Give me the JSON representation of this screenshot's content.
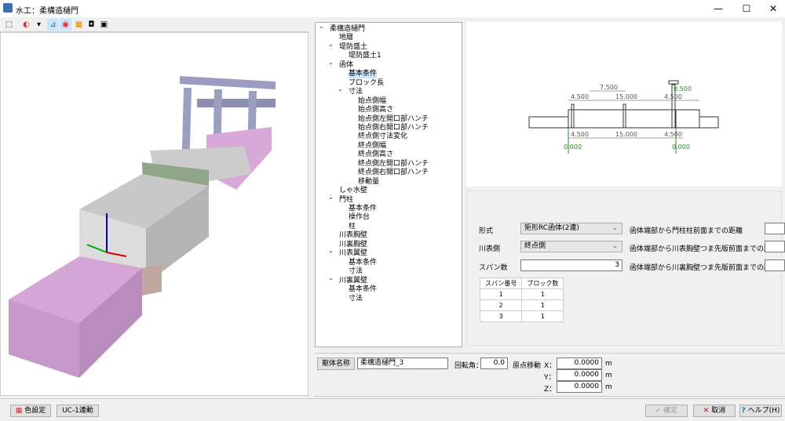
{
  "window": {
    "title": "水工：柔構造樋門",
    "minimize": "—",
    "maximize": "☐",
    "close": "✕"
  },
  "toolbar": {
    "icons": [
      "select-icon",
      "color-view-icon",
      "dropdown-icon",
      "axis-icon",
      "target-icon",
      "palette-icon",
      "camera-icon",
      "movie-icon"
    ]
  },
  "tree": [
    {
      "label": "柔構造樋門",
      "depth": 0,
      "exp": true
    },
    {
      "label": "地層",
      "depth": 1
    },
    {
      "label": "堤防盛土",
      "depth": 1,
      "exp": true
    },
    {
      "label": "堤防盛土1",
      "depth": 2
    },
    {
      "label": "函体",
      "depth": 1,
      "exp": true
    },
    {
      "label": "基本条件",
      "depth": 2,
      "selected": true
    },
    {
      "label": "ブロック長",
      "depth": 2
    },
    {
      "label": "寸法",
      "depth": 2,
      "exp": true
    },
    {
      "label": "始点側幅",
      "depth": 3
    },
    {
      "label": "始点側高さ",
      "depth": 3
    },
    {
      "label": "始点側左開口部ハンチ",
      "depth": 3
    },
    {
      "label": "始点側右開口部ハンチ",
      "depth": 3
    },
    {
      "label": "終点側寸法変化",
      "depth": 3
    },
    {
      "label": "終点側幅",
      "depth": 3
    },
    {
      "label": "終点側高さ",
      "depth": 3
    },
    {
      "label": "終点側左開口部ハンチ",
      "depth": 3
    },
    {
      "label": "終点側右開口部ハンチ",
      "depth": 3
    },
    {
      "label": "移動量",
      "depth": 3
    },
    {
      "label": "しゃ水壁",
      "depth": 1
    },
    {
      "label": "門柱",
      "depth": 1,
      "exp": true
    },
    {
      "label": "基本条件",
      "depth": 2
    },
    {
      "label": "操作台",
      "depth": 2
    },
    {
      "label": "柱",
      "depth": 2
    },
    {
      "label": "川表胸壁",
      "depth": 1
    },
    {
      "label": "川裏胸壁",
      "depth": 1
    },
    {
      "label": "川表翼壁",
      "depth": 1,
      "exp": true
    },
    {
      "label": "基本条件",
      "depth": 2
    },
    {
      "label": "寸法",
      "depth": 2
    },
    {
      "label": "川裏翼壁",
      "depth": 1,
      "exp": true
    },
    {
      "label": "基本条件",
      "depth": 2
    },
    {
      "label": "寸法",
      "depth": 2
    }
  ],
  "drawing": {
    "top_dims": [
      "4.500",
      "7.500",
      "15.000",
      "4.500",
      "0.500"
    ],
    "bottom_dims": [
      "4.500",
      "15.000",
      "4.500"
    ],
    "elev_left": "0.000",
    "elev_right": "0.000"
  },
  "form": {
    "type_label": "形式",
    "type_value": "矩形RC函体(2連)",
    "side_label": "川表側",
    "side_value": "終点側",
    "span_label": "スパン数",
    "span_value": "3",
    "dist1_label": "函体端部から門柱柱前面までの距離",
    "dist2_label": "函体端部から川表胸壁つま先版前面までの距離",
    "dist3_label": "函体端部から川裏胸壁つま先版前面までの距離",
    "table": {
      "headers": [
        "スパン番号",
        "ブロック数"
      ],
      "rows": [
        [
          "1",
          "1"
        ],
        [
          "2",
          "1"
        ],
        [
          "3",
          "1"
        ]
      ]
    }
  },
  "bottom": {
    "name_btn": "躯体名称",
    "name_value": "柔構造樋門_3",
    "rot_label": "回転角：",
    "rot_value": "0.0",
    "origin_label": "原点移動",
    "x_label": "X：",
    "y_label": "Y：",
    "z_label": "Z：",
    "x": "0.0000",
    "y": "0.0000",
    "z": "0.0000",
    "unit": "m"
  },
  "footer": {
    "color_btn": "色設定",
    "uc1_btn": "UC-1連動",
    "ok_btn": "確定",
    "cancel_btn": "取消",
    "help_btn": "ヘルプ(H)"
  }
}
